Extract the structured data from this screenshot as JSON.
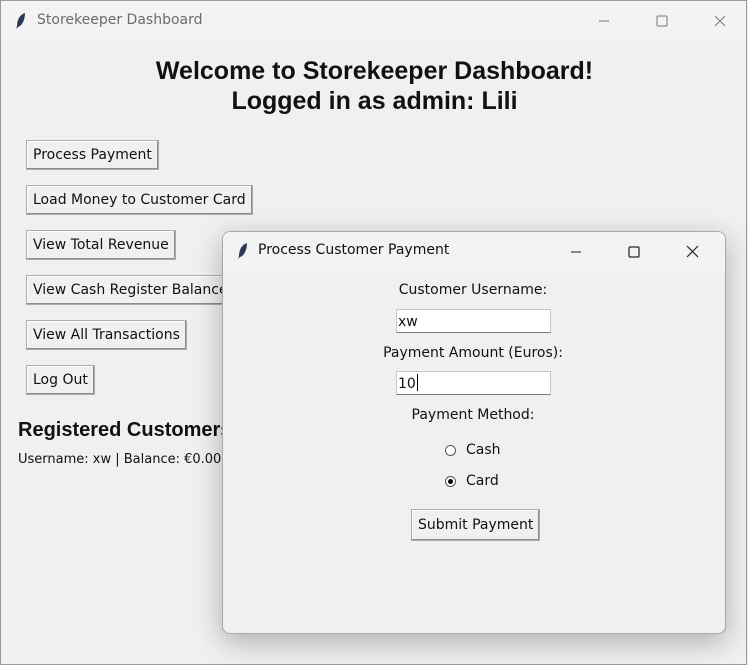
{
  "main_window": {
    "title": "Storekeeper Dashboard",
    "welcome_line1": "Welcome to Storekeeper Dashboard!",
    "welcome_line2": "Logged in as admin: Lili",
    "buttons": [
      {
        "label": "Process Payment"
      },
      {
        "label": "Load Money to Customer Card"
      },
      {
        "label": "View Total Revenue"
      },
      {
        "label": "View Cash Register Balance"
      },
      {
        "label": "View All Transactions"
      },
      {
        "label": "Log Out"
      }
    ],
    "registered_title": "Registered Customers",
    "customers": [
      {
        "line": "Username: xw | Balance: €0.00"
      }
    ]
  },
  "dialog": {
    "title": "Process Customer Payment",
    "username_label": "Customer Username:",
    "username_value": "xw",
    "amount_label": "Payment Amount (Euros):",
    "amount_value": "10",
    "method_label": "Payment Method:",
    "methods": [
      {
        "label": "Cash",
        "selected": false
      },
      {
        "label": "Card",
        "selected": true
      }
    ],
    "submit_label": "Submit Payment"
  },
  "icons": {
    "app": "feather-icon",
    "minimize": "minimize-icon",
    "maximize": "maximize-icon",
    "close": "close-icon"
  }
}
